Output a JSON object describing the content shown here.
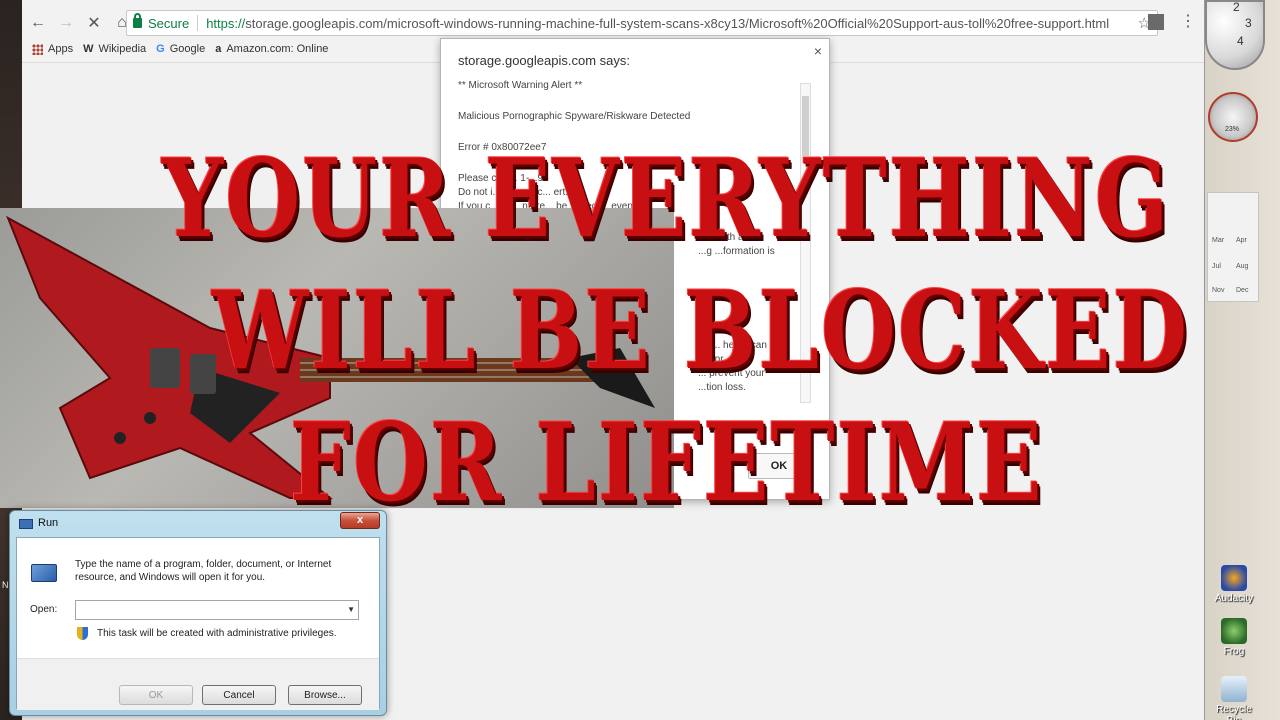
{
  "browser": {
    "security_label": "Secure",
    "url_scheme": "https://",
    "url_rest": "storage.googleapis.com/microsoft-windows-running-machine-full-system-scans-x8cy13/Microsoft%20Official%20Support-aus-toll%20free-support.html",
    "bookmarks": [
      {
        "icon": "apps-icon",
        "label": "Apps"
      },
      {
        "icon": "W",
        "label": "Wikipedia"
      },
      {
        "icon": "G",
        "label": "Google"
      },
      {
        "icon": "a",
        "label": "Amazon.com: Online"
      }
    ]
  },
  "alert": {
    "title": "storage.googleapis.com says:",
    "lines": [
      "** Microsoft Warning  Alert  **",
      "Malicious Pornographic  Spyware/Riskware Detected",
      "Error # 0x80072ee7",
      "Please call ... 1-...95",
      "Do not i... this critic... ert.",
      "If you c... , y... ntere... be... bled ... event",
      "...te with a",
      "...g ...formation is",
      "...n... heers can wi...",
      "...o pr...",
      "... prevent your",
      "...tion loss."
    ],
    "ok_label": "OK"
  },
  "overlay": {
    "line1": "YOUR EVERYTHING",
    "line2": "WILL BE BLOCKED",
    "line3": "FOR LIFETIME"
  },
  "run": {
    "title": "Run",
    "close_label": "x",
    "description": "Type the name of a program, folder, document, or Internet resource, and Windows will open it for you.",
    "open_label": "Open:",
    "input_value": "",
    "admin_note": "This task will be created with administrative privileges.",
    "ok_label": "OK",
    "cancel_label": "Cancel",
    "browse_label": "Browse..."
  },
  "gadgets": {
    "clock_numbers": [
      "2",
      "3",
      "4"
    ],
    "meter_value": "23%",
    "calendar_months": [
      "Mar",
      "Apr",
      "Jul",
      "Aug",
      "Nov",
      "Dec"
    ]
  },
  "desktop_icons": [
    "Audacity",
    "Frog",
    "Recycle Bin"
  ],
  "left_strip_text": "N\nA"
}
